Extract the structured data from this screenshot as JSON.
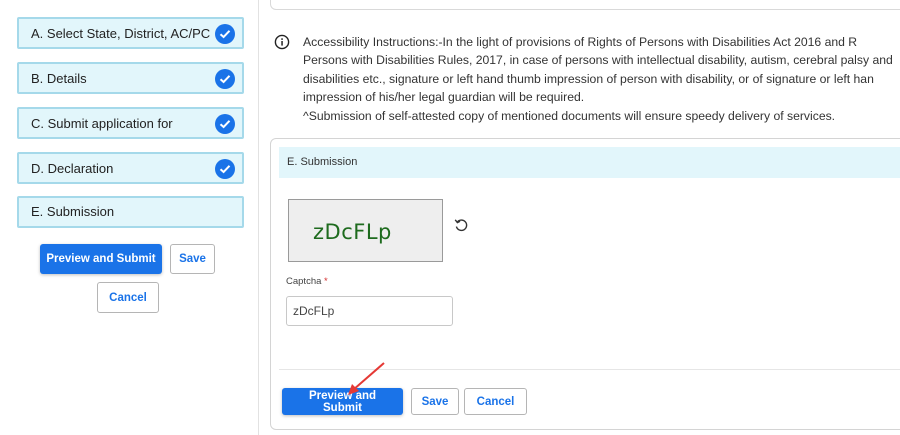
{
  "steps": [
    {
      "label": "A. Select State, District, AC/PC",
      "completed": true
    },
    {
      "label": "B. Details",
      "completed": true
    },
    {
      "label": "C. Submit application for",
      "completed": true
    },
    {
      "label": "D. Declaration",
      "completed": true
    },
    {
      "label": "E. Submission",
      "completed": false
    }
  ],
  "left_actions": {
    "preview_submit": "Preview and Submit",
    "save": "Save",
    "cancel": "Cancel"
  },
  "instructions": {
    "lines": [
      "Accessibility Instructions:-In the light of provisions of Rights of Persons with Disabilities Act 2016 and R",
      "Persons with Disabilities Rules, 2017, in case of persons with intellectual disability, autism, cerebral palsy and",
      "disabilities etc., signature or left hand thumb impression of person with disability, or of signature or left han",
      "impression of his/her legal guardian will be required.",
      "^Submission of self-attested copy of mentioned documents will ensure speedy delivery of services."
    ]
  },
  "submission": {
    "header": "E. Submission",
    "captcha_image_text": "zDcFLp",
    "captcha_label": "Captcha",
    "captcha_required_mark": "*",
    "captcha_value": "zDcFLp",
    "preview_submit": "Preview and Submit",
    "save": "Save",
    "cancel": "Cancel"
  },
  "colors": {
    "primary": "#1a73e8",
    "step_bg": "#e2f6fb",
    "step_border": "#a5d9ea",
    "annotation_arrow": "#e53935"
  }
}
